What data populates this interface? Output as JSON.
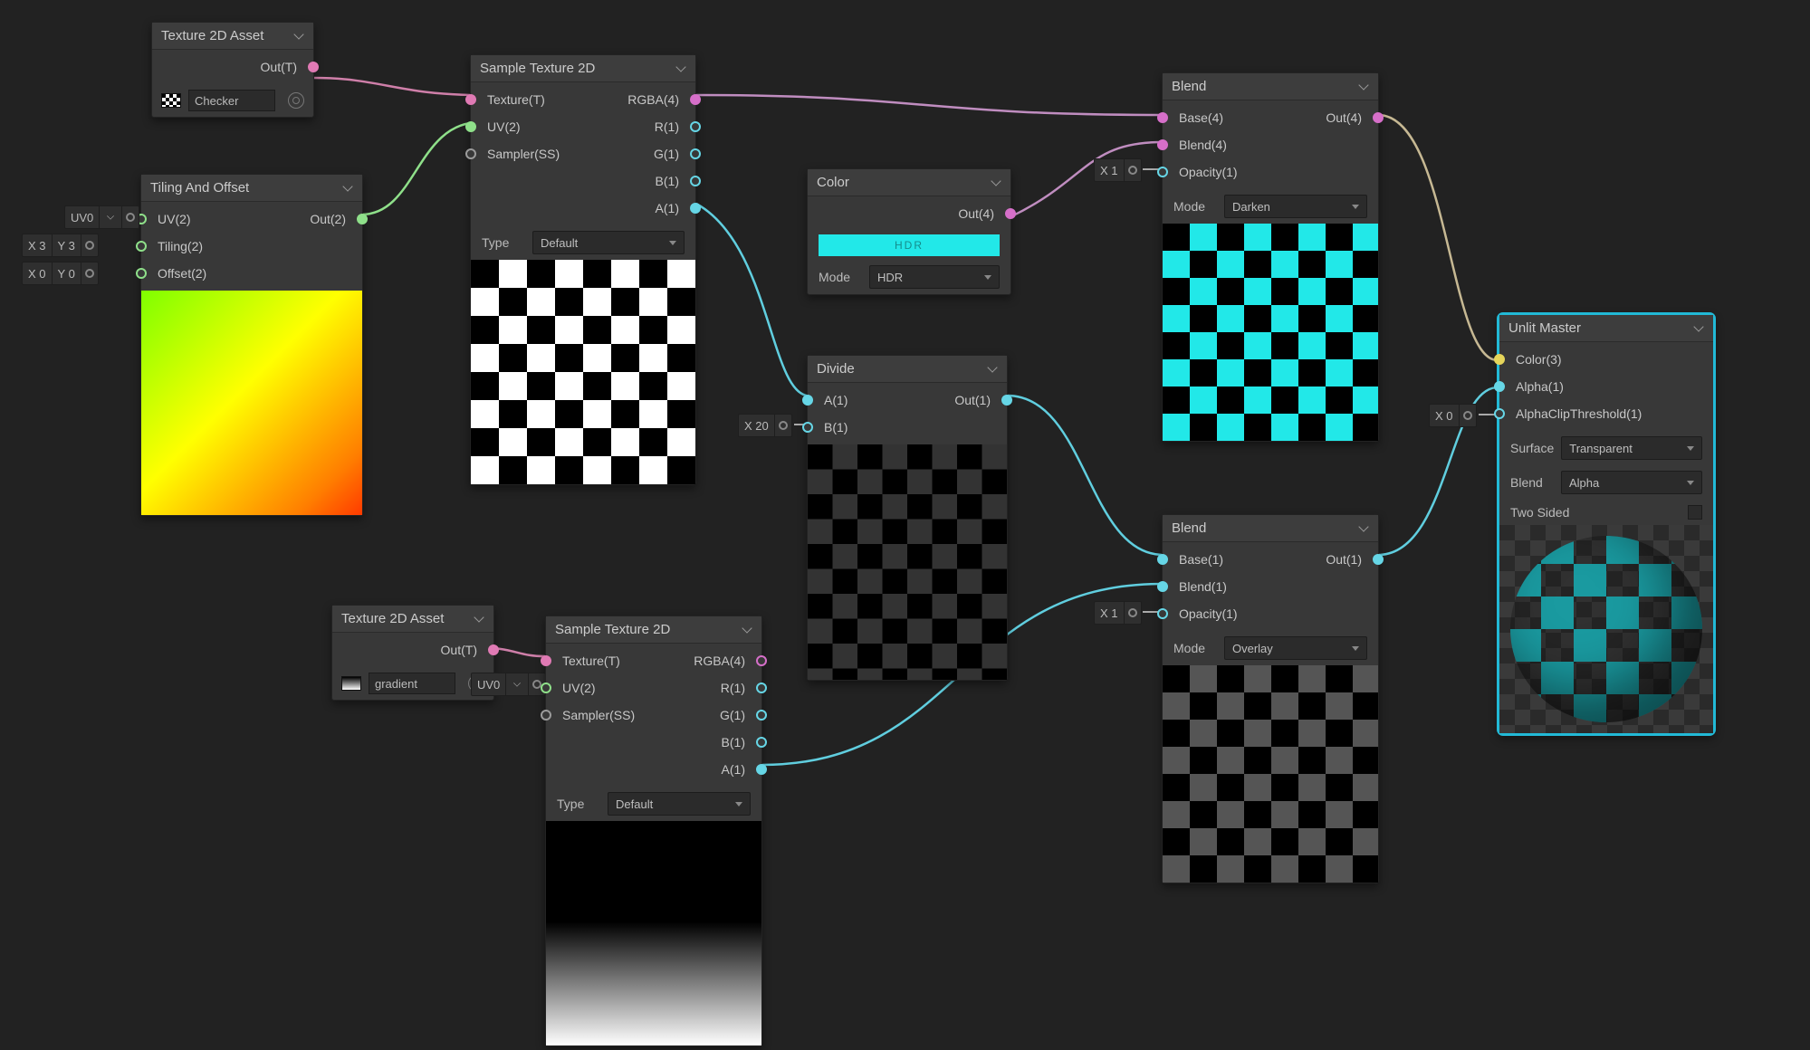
{
  "canvas": {
    "bg": "#222"
  },
  "nodes": {
    "tex2d_a": {
      "title": "Texture 2D Asset",
      "out": "Out(T)",
      "asset": "Checker"
    },
    "tex2d_b": {
      "title": "Texture 2D Asset",
      "out": "Out(T)",
      "asset": "gradient"
    },
    "tiling": {
      "title": "Tiling And Offset",
      "uv": "UV(2)",
      "tiling": "Tiling(2)",
      "offset": "Offset(2)",
      "out": "Out(2)"
    },
    "sample_a": {
      "title": "Sample Texture 2D",
      "tex": "Texture(T)",
      "uv": "UV(2)",
      "sampler": "Sampler(SS)",
      "rgba": "RGBA(4)",
      "r": "R(1)",
      "g": "G(1)",
      "b": "B(1)",
      "a": "A(1)",
      "type_lbl": "Type",
      "type_val": "Default"
    },
    "sample_b": {
      "title": "Sample Texture 2D",
      "tex": "Texture(T)",
      "uv": "UV(2)",
      "sampler": "Sampler(SS)",
      "rgba": "RGBA(4)",
      "r": "R(1)",
      "g": "G(1)",
      "b": "B(1)",
      "a": "A(1)",
      "type_lbl": "Type",
      "type_val": "Default"
    },
    "color": {
      "title": "Color",
      "out": "Out(4)",
      "mode_lbl": "Mode",
      "mode_val": "HDR"
    },
    "divide": {
      "title": "Divide",
      "a": "A(1)",
      "b": "B(1)",
      "out": "Out(1)"
    },
    "blend_a": {
      "title": "Blend",
      "base": "Base(4)",
      "blend": "Blend(4)",
      "opacity": "Opacity(1)",
      "out": "Out(4)",
      "mode_lbl": "Mode",
      "mode_val": "Darken"
    },
    "blend_b": {
      "title": "Blend",
      "base": "Base(1)",
      "blend": "Blend(1)",
      "opacity": "Opacity(1)",
      "out": "Out(1)",
      "mode_lbl": "Mode",
      "mode_val": "Overlay"
    },
    "master": {
      "title": "Unlit Master",
      "color": "Color(3)",
      "alpha": "Alpha(1)",
      "aclip": "AlphaClipThreshold(1)",
      "surf_lbl": "Surface",
      "surf_val": "Transparent",
      "blend_lbl": "Blend",
      "blend_val": "Alpha",
      "two_sided": "Two Sided"
    }
  },
  "chips": {
    "uv0_a": "UV0",
    "tiling": {
      "x": "X 3",
      "y": "Y 3"
    },
    "offset": {
      "x": "X 0",
      "y": "Y 0"
    },
    "div_b": "X 20",
    "blend_a_op": "X 1",
    "blend_b_op": "X 1",
    "uv0_b": "UV0",
    "aclip": "X 0"
  }
}
